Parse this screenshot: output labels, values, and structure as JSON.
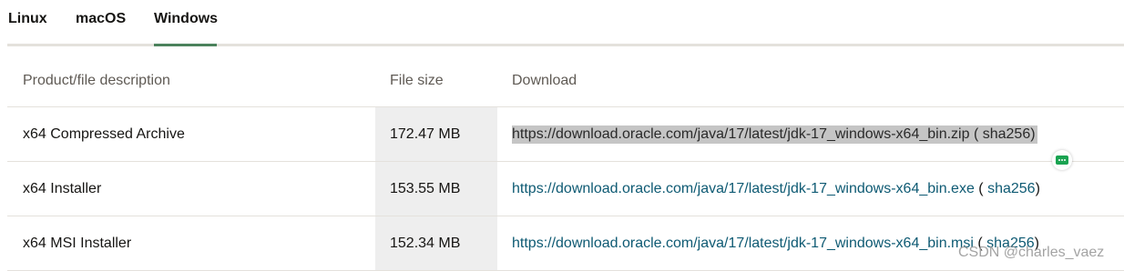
{
  "tabs": [
    {
      "label": "Linux"
    },
    {
      "label": "macOS"
    },
    {
      "label": "Windows"
    }
  ],
  "active_tab": "Windows",
  "accent_color": "#4c825c",
  "table": {
    "headers": {
      "description": "Product/file description",
      "size": "File size",
      "download": "Download"
    },
    "rows": [
      {
        "description": "x64 Compressed Archive",
        "size": "172.47 MB",
        "link": "https://download.oracle.com/java/17/latest/jdk-17_windows-x64_bin.zip",
        "sha_open": " ( ",
        "sha": "sha256",
        "sha_close": ")"
      },
      {
        "description": "x64 Installer",
        "size": "153.55 MB",
        "link": "https://download.oracle.com/java/17/latest/jdk-17_windows-x64_bin.exe",
        "sha_open": " ( ",
        "sha": "sha256",
        "sha_close": ")"
      },
      {
        "description": "x64 MSI Installer",
        "size": "152.34 MB",
        "link": "https://download.oracle.com/java/17/latest/jdk-17_windows-x64_bin.msi",
        "sha_open": " ( ",
        "sha": "sha256",
        "sha_close": ")"
      }
    ]
  },
  "watermark": "CSDN @charles_vaez",
  "icons": {
    "chat": "chat-bubble-icon"
  }
}
